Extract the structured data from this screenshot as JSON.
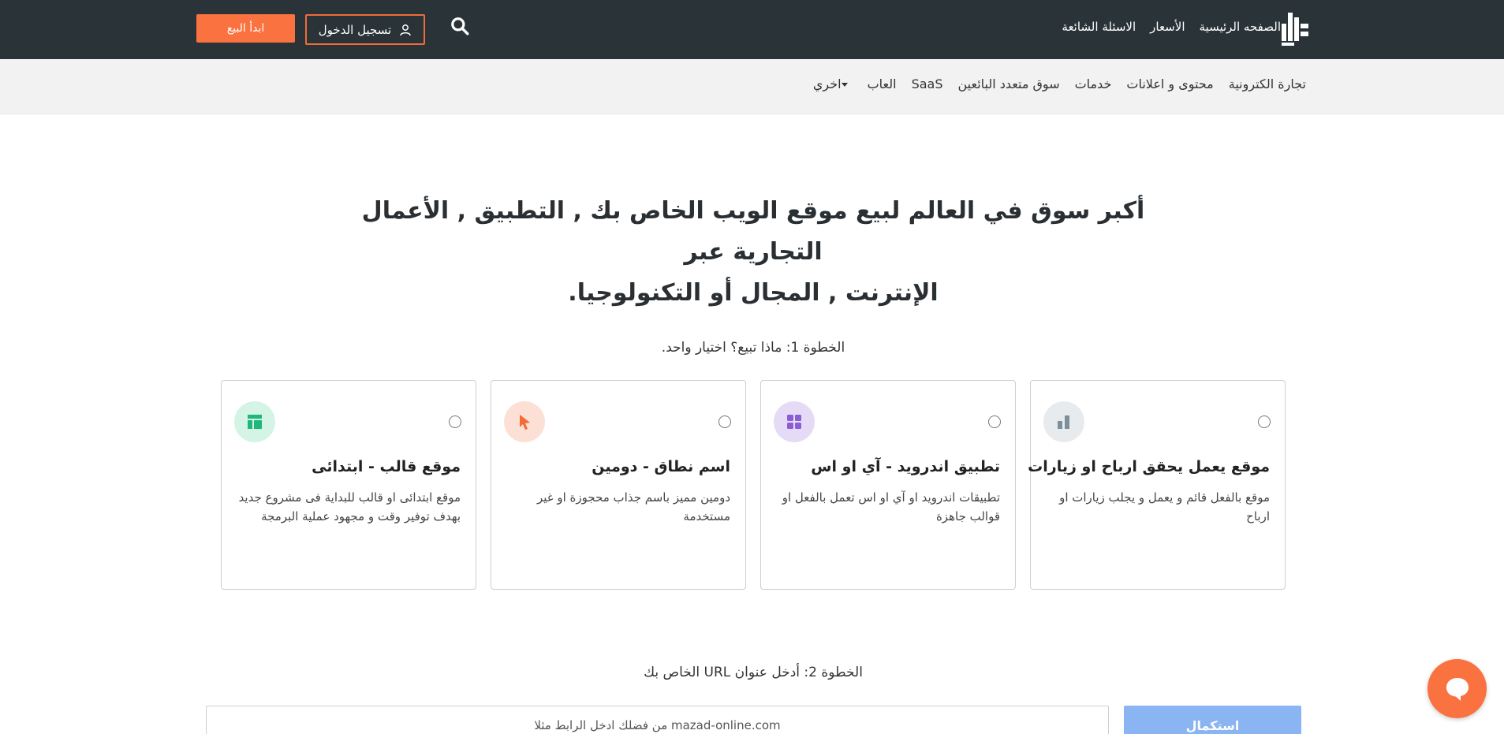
{
  "header": {
    "nav": [
      "الصفحه الرئيسية",
      "الأسعار",
      "الاسئلة الشائعة"
    ],
    "login_label": "تسجيل الدخول",
    "sell_label": "ابدأ البيع"
  },
  "categories": {
    "items": [
      "تجارة الكترونية",
      "محتوى و اعلانات",
      "خدمات",
      "سوق متعدد البائعين",
      "SaaS",
      "العاب"
    ],
    "more_label": "اخري"
  },
  "hero": {
    "line1": "أكبر سوق في العالم لبيع موقع الويب الخاص بك , التطبيق , الأعمال التجارية عبر",
    "line2": "الإنترنت , المجال أو التكنولوجيا."
  },
  "step1": {
    "label": "الخطوة 1: ماذا تبيع؟ اختيار واحد."
  },
  "cards": [
    {
      "title": "موقع يعمل يحقق ارباح او زيارات",
      "desc": "موقع بالفعل قائم و يعمل و يجلب زيارات او ارباح",
      "icon": "bar-chart-icon",
      "color": "#7d8f9b",
      "bg": "#e8ebee"
    },
    {
      "title": "تطبيق اندرويد - آي او اس",
      "desc": "تطبيقات اندرويد او آي او اس تعمل بالفعل او قوالب جاهزة",
      "icon": "grid-apps-icon",
      "color": "#8a5fd3",
      "bg": "#e6dbf7"
    },
    {
      "title": "اسم نطاق - دومين",
      "desc": "دومين مميز باسم جذاب محجوزة او غير مستخدمة",
      "icon": "cursor-pointer-icon",
      "color": "#f26b38",
      "bg": "#fde0d5"
    },
    {
      "title": "موقع قالب - ابتدائى",
      "desc": "موقع ابتدائى او قالب للبداية فى مشروع جديد بهدف توفير وقت و مجهود عملية البرمجة",
      "icon": "layout-template-icon",
      "color": "#1fb87a",
      "bg": "#d4f4e6"
    }
  ],
  "step2": {
    "label": "الخطوة 2: أدخل عنوان URL الخاص بك"
  },
  "url": {
    "placeholder": "من فضلك ادخل الرابط مثلا mazad-online.com",
    "value": ""
  },
  "complete_label": "استكمال",
  "colors": {
    "topbar": "#293338",
    "accent": "#f9723f",
    "button_disabled": "#8ab4f2"
  }
}
